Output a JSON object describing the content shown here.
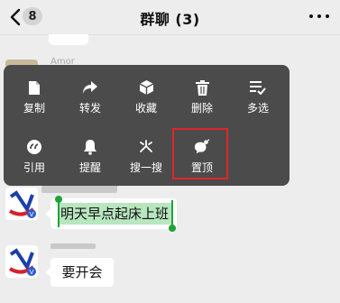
{
  "header": {
    "unread_count": "8",
    "title": "群聊 (3)"
  },
  "messages": {
    "top_sender": "Amor"
  },
  "context_menu": {
    "items": [
      {
        "label": "复制",
        "icon": "copy-icon"
      },
      {
        "label": "转发",
        "icon": "forward-icon"
      },
      {
        "label": "收藏",
        "icon": "favorite-icon"
      },
      {
        "label": "删除",
        "icon": "delete-icon"
      },
      {
        "label": "多选",
        "icon": "multi-select-icon"
      },
      {
        "label": "引用",
        "icon": "quote-icon"
      },
      {
        "label": "提醒",
        "icon": "bell-icon"
      },
      {
        "label": "搜一搜",
        "icon": "search-icon"
      },
      {
        "label": "置顶",
        "icon": "pin-top-icon"
      }
    ],
    "highlighted_item": "置顶",
    "highlight_color": "#e0262b"
  },
  "selected_message": {
    "text": "明天早点起床上班",
    "selection_color": "#b8e6bf",
    "handle_color": "#1fa339"
  },
  "next_message": {
    "text": "要开会"
  }
}
